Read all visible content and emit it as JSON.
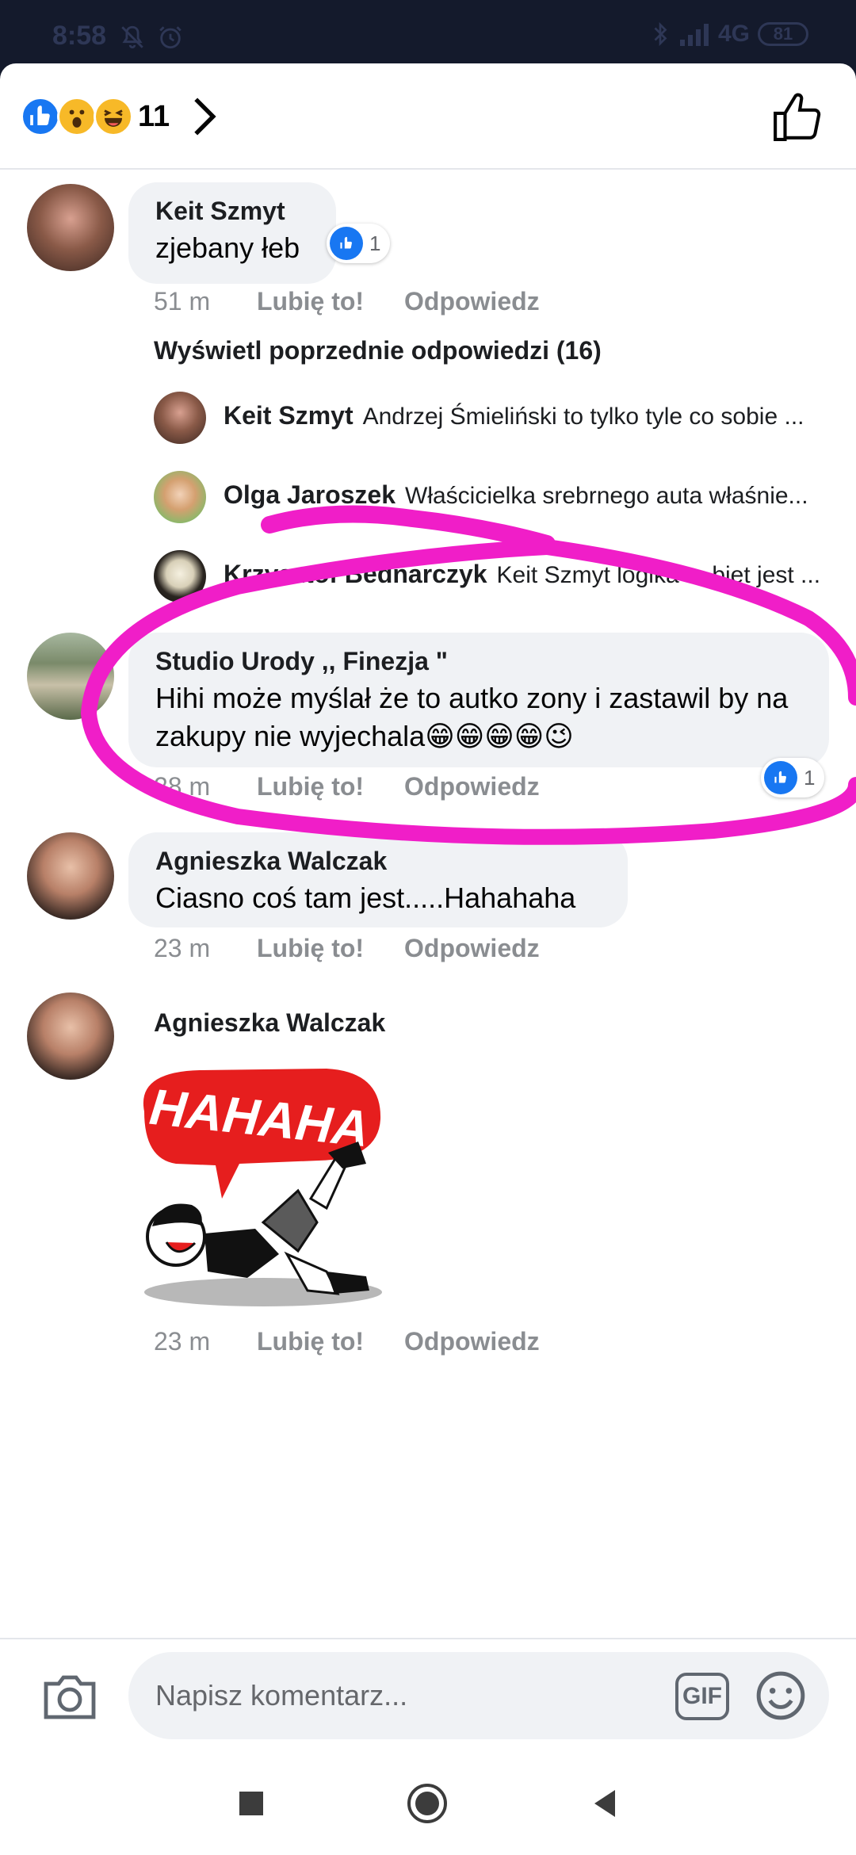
{
  "status_bar": {
    "time": "8:58",
    "network": "4G",
    "battery": "81",
    "icons": [
      "notifications-off-icon",
      "alarm-icon",
      "bluetooth-icon",
      "signal-icon"
    ]
  },
  "reactions": {
    "types": [
      "like",
      "wow",
      "haha"
    ],
    "count": "11"
  },
  "comments": [
    {
      "author": "Keit Szmyt",
      "text": "zjebany łeb",
      "time": "51 m",
      "like_label": "Lubię to!",
      "reply_label": "Odpowiedz",
      "likes": "1"
    },
    {
      "author": "Studio Urody  ,, Finezja \"",
      "text": "Hihi może myślał że  to autko zony i zastawil by na zakupy nie wyjechala😁😁😁😁😉",
      "time": "28 m",
      "like_label": "Lubię to!",
      "reply_label": "Odpowiedz",
      "likes": "1"
    },
    {
      "author": "Agnieszka Walczak",
      "text": "Ciasno coś tam jest.....Hahahaha",
      "time": "23 m",
      "like_label": "Lubię to!",
      "reply_label": "Odpowiedz"
    },
    {
      "author": "Agnieszka Walczak",
      "sticker_text": "HAHAHA",
      "time": "23 m",
      "like_label": "Lubię to!",
      "reply_label": "Odpowiedz"
    }
  ],
  "previous_replies_label": "Wyświetl poprzednie odpowiedzi (16)",
  "replies": [
    {
      "author": "Keit Szmyt",
      "text": "Andrzej Śmieliński to tylko tyle co sobie ..."
    },
    {
      "author": "Olga Jaroszek",
      "text": "Właścicielka srebrnego auta właśnie..."
    },
    {
      "author": "Krzysztof Bednarczyk",
      "text": "Keit Szmyt logika to biet jest ..."
    }
  ],
  "input": {
    "placeholder": "Napisz komentarz...",
    "gif_label": "GIF"
  },
  "colors": {
    "accent": "#1877f2",
    "annotation": "#f01ec8",
    "bubble": "#f0f2f5",
    "status_bg": "#141a2c"
  }
}
